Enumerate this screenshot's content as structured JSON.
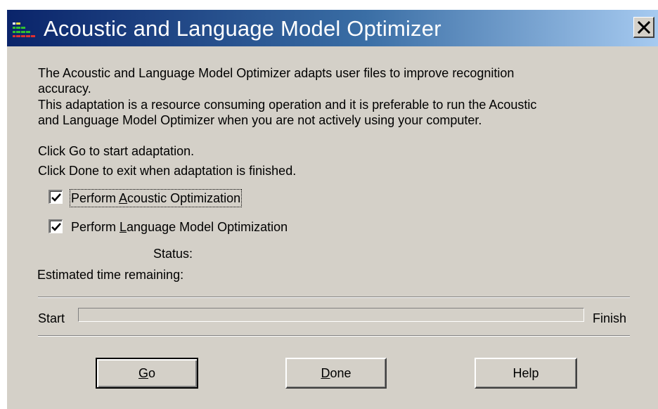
{
  "window": {
    "title": "Acoustic and Language Model Optimizer",
    "close_label": "Close"
  },
  "description": {
    "line1": "The Acoustic and Language Model Optimizer adapts user files to improve recognition",
    "line2": "accuracy.",
    "line3": "This adaptation is a resource consuming operation and it is preferable to run the Acoustic",
    "line4": "and Language Model Optimizer when you are not actively using your computer."
  },
  "instructions": {
    "go": "Click Go to start adaptation.",
    "done": "Click Done to exit when adaptation is finished."
  },
  "options": {
    "acoustic": {
      "label_before": "Perform ",
      "label_accel": "A",
      "label_after": "coustic Optimization",
      "checked": true
    },
    "language": {
      "label_before": "Perform ",
      "label_accel": "L",
      "label_after": "anguage Model Optimization",
      "checked": true
    }
  },
  "status": {
    "status_label": "Status:",
    "status_value": "",
    "time_label": "Estimated time remaining:",
    "time_value": ""
  },
  "progress": {
    "start_label": "Start",
    "finish_label": "Finish",
    "value": 0
  },
  "buttons": {
    "go": {
      "accel": "G",
      "rest": "o"
    },
    "done": {
      "accel": "D",
      "rest": "one"
    },
    "help": {
      "label": "Help"
    }
  }
}
